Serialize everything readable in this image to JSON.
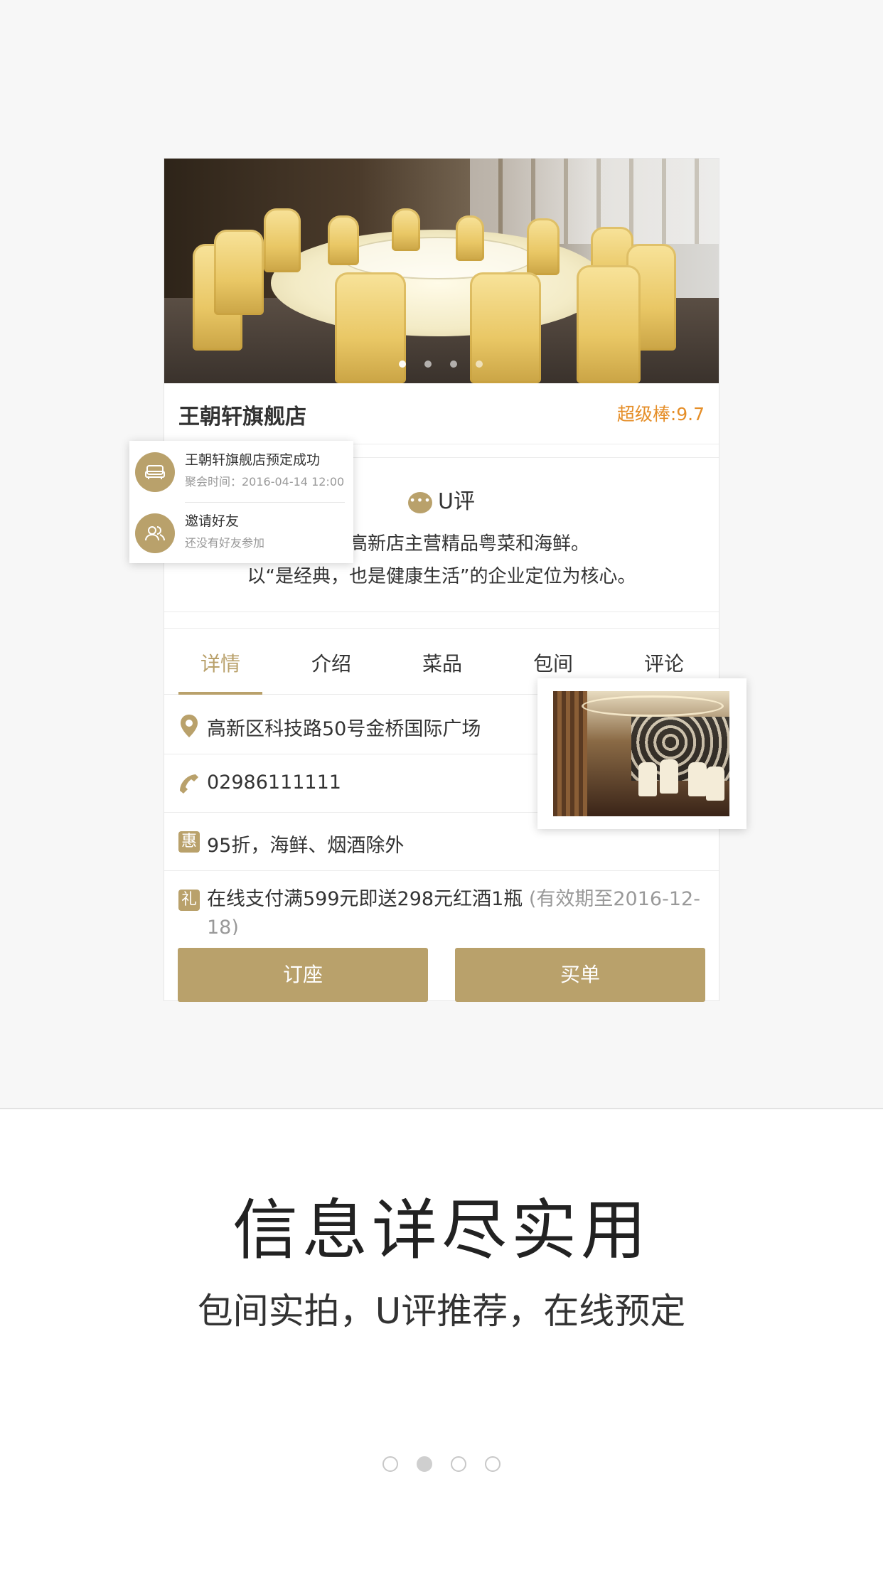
{
  "shop": {
    "name": "王朝轩旗舰店",
    "score": "超级棒:9.7"
  },
  "popup": {
    "booking_title": "王朝轩旗舰店预定成功",
    "booking_sub": "聚会时间：2016-04-14 12:00",
    "invite_title": "邀请好友",
    "invite_sub": "还没有好友参加"
  },
  "review": {
    "title": "U评",
    "line1": "王朝轩高新店主营精品粤菜和海鲜。",
    "line2": "以“是经典，也是健康生活”的企业定位为核心。"
  },
  "tabs": [
    "详情",
    "介绍",
    "菜品",
    "包间",
    "评论"
  ],
  "info": {
    "address": "高新区科技路50号金桥国际广场",
    "phone": "02986111111",
    "discount_badge": "惠",
    "discount": "95折，海鲜、烟酒除外",
    "gift_badge": "礼",
    "gift": "在线支付满599元即送298元红酒1瓶",
    "gift_note": "(有效期至2016-12-18)"
  },
  "buttons": {
    "reserve": "订座",
    "pay": "买单"
  },
  "headline": "信息详尽实用",
  "subline": "包间实拍，U评推荐，在线预定",
  "pager": {
    "total": 4,
    "active": 2
  },
  "colors": {
    "accent": "#b9a16b",
    "score": "#e58e28"
  }
}
